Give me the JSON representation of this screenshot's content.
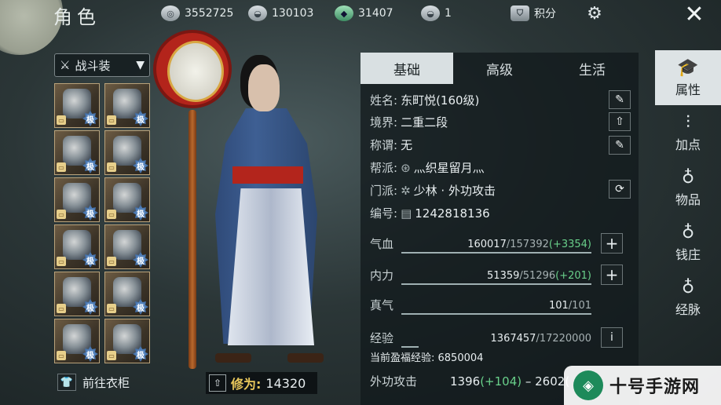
{
  "header": {
    "title": "角色",
    "resources": [
      {
        "icon": "silver-coin-icon",
        "value": "3552725"
      },
      {
        "icon": "silver-ingot-icon",
        "value": "130103"
      },
      {
        "icon": "jade-icon",
        "value": "31407"
      },
      {
        "icon": "gold-ingot-icon",
        "value": "1"
      }
    ],
    "score_label": "积分",
    "close_icon": "close-icon"
  },
  "left": {
    "outfit_label": "战斗装",
    "slot_badge": "极",
    "wardrobe_label": "前往衣柜",
    "cultivation_label": "修为:",
    "cultivation_value": "14320"
  },
  "panel": {
    "tabs": [
      "基础",
      "高级",
      "生活"
    ],
    "info": {
      "name_k": "姓名:",
      "name_v": "东町悦(160级)",
      "realm_k": "境界:",
      "realm_v": "二重二段",
      "title_k": "称谓:",
      "title_v": "无",
      "guild_k": "帮派:",
      "guild_v": "灬织星留月灬",
      "sect_k": "门派:",
      "sect_v": "少林 · 外功攻击",
      "id_k": "编号:",
      "id_v": "1242818136"
    },
    "stats": {
      "hp_k": "气血",
      "hp_cur": "160017",
      "hp_max": "/157392",
      "hp_bonus": "(+3354)",
      "mp_k": "内力",
      "mp_cur": "51359",
      "mp_max": "/51296",
      "mp_bonus": "(+201)",
      "qi_k": "真气",
      "qi_cur": "101",
      "qi_max": "/101",
      "exp_k": "经验",
      "exp_cur": "1367457",
      "exp_max": "/17220000",
      "bonus_exp": "当前盈福经验: 6850004",
      "atk_k": "外功攻击",
      "atk_min": "1396",
      "atk_min_bonus": "(+104)",
      "atk_sep": " – ",
      "atk_max": "2602("
    }
  },
  "side_tabs": [
    {
      "label": "属性",
      "icon": "attribute-icon"
    },
    {
      "label": "加点",
      "icon": "sliders-icon"
    },
    {
      "label": "物品",
      "icon": "bag-icon"
    },
    {
      "label": "钱庄",
      "icon": "money-bag-icon"
    },
    {
      "label": "经脉",
      "icon": "meridian-icon"
    }
  ],
  "watermark": "十号手游网"
}
